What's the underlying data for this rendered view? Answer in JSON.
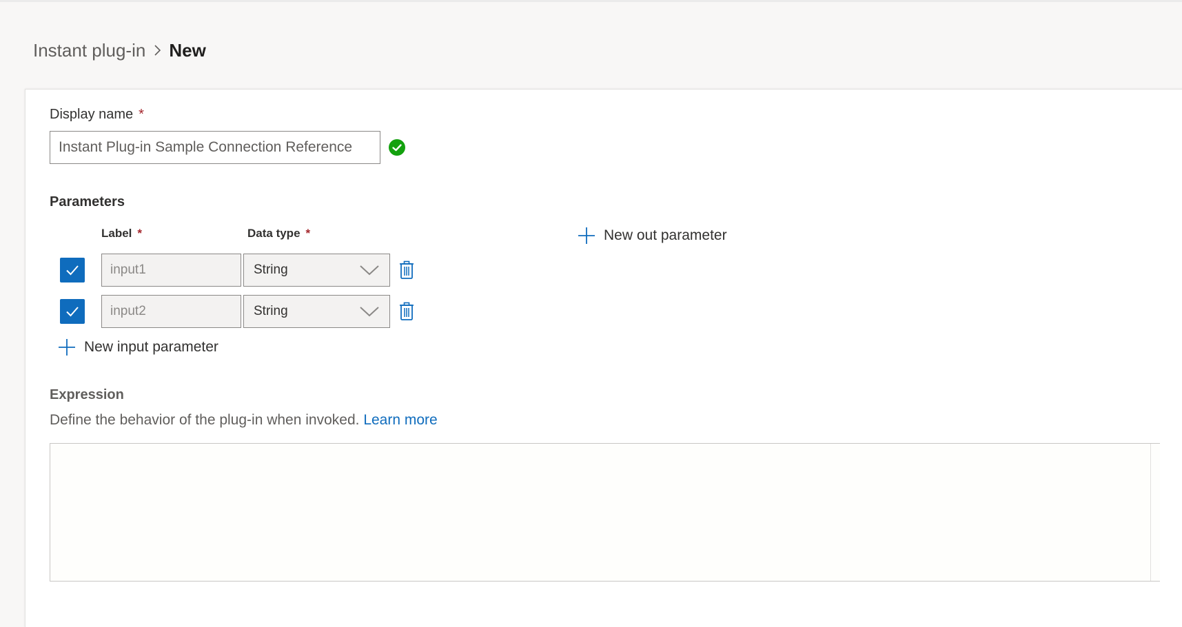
{
  "breadcrumb": {
    "parent": "Instant plug-in",
    "current": "New"
  },
  "display_name": {
    "label": "Display name",
    "required_mark": "*",
    "value": "Instant Plug-in Sample Connection Reference",
    "status_icon": "check-circle-icon"
  },
  "parameters": {
    "title": "Parameters",
    "label_header": "Label",
    "data_type_header": "Data type",
    "required_mark": "*",
    "new_out_label": "New out parameter",
    "new_input_label": "New input parameter",
    "rows": [
      {
        "checked": true,
        "label": "input1",
        "data_type": "String"
      },
      {
        "checked": true,
        "label": "input2",
        "data_type": "String"
      }
    ]
  },
  "expression": {
    "title": "Expression",
    "description": "Define the behavior of the plug-in when invoked.",
    "learn_more": "Learn more",
    "value": ""
  },
  "colors": {
    "accent": "#0f6cbd",
    "required": "#a4262c",
    "valid": "#13a10e",
    "page_background": "#f8f7f6"
  }
}
